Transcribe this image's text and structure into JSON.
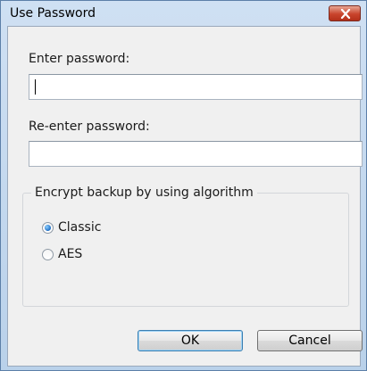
{
  "window": {
    "title": "Use Password"
  },
  "fields": {
    "password": {
      "label": "Enter password:",
      "value": ""
    },
    "confirm": {
      "label": "Re-enter password:",
      "value": ""
    }
  },
  "algorithm": {
    "legend": "Encrypt backup by using algorithm",
    "options": [
      {
        "label": "Classic",
        "selected": true
      },
      {
        "label": "AES",
        "selected": false
      }
    ]
  },
  "buttons": {
    "ok": "OK",
    "cancel": "Cancel"
  },
  "icons": {
    "close": "close-icon",
    "radio_selected": "radio-selected-icon"
  },
  "colors": {
    "title_bar": "#c4d8ee",
    "close_button": "#c9442c",
    "dialog_background": "#f0f0f0"
  }
}
